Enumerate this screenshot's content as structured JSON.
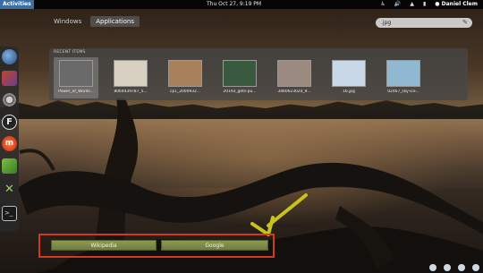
{
  "topbar": {
    "activities": "Activities",
    "clock": "Thu Oct 27,  9:19 PM",
    "user": "Daniel Clem"
  },
  "overview": {
    "tabs": [
      {
        "label": "Windows",
        "active": false
      },
      {
        "label": "Applications",
        "active": true
      }
    ],
    "search_value": ".jpg"
  },
  "recent": {
    "title": "RECENT ITEMS",
    "items": [
      {
        "caption": "Power_of_Words...",
        "selected": true,
        "color": "#6a6a6a"
      },
      {
        "caption": "8064439787_5...",
        "selected": false,
        "color": "#d8d0c0"
      },
      {
        "caption": "cp1_2000932...",
        "selected": false,
        "color": "#a8805a"
      },
      {
        "caption": "20193_gets-pu...",
        "selected": false,
        "color": "#3a5a40"
      },
      {
        "caption": "3460623020_9...",
        "selected": false,
        "color": "#9a8a80"
      },
      {
        "caption": "16.jpg",
        "selected": false,
        "color": "#c8d8e6"
      },
      {
        "caption": "02467_sky-ice...",
        "selected": false,
        "color": "#90b8d0"
      }
    ]
  },
  "dash": {
    "icons": [
      "globe-icon",
      "shield-bird-icon",
      "gear-icon",
      "f-logo-icon",
      "m-logo-icon",
      "cube-icon",
      "tools-icon",
      "terminal-icon"
    ]
  },
  "buttons": {
    "wikipedia": "Wikipedia",
    "google": "Google"
  },
  "colors": {
    "highlight_box": "#d23a1f",
    "arrow": "#c8c21e",
    "button": "#7c8a45"
  }
}
